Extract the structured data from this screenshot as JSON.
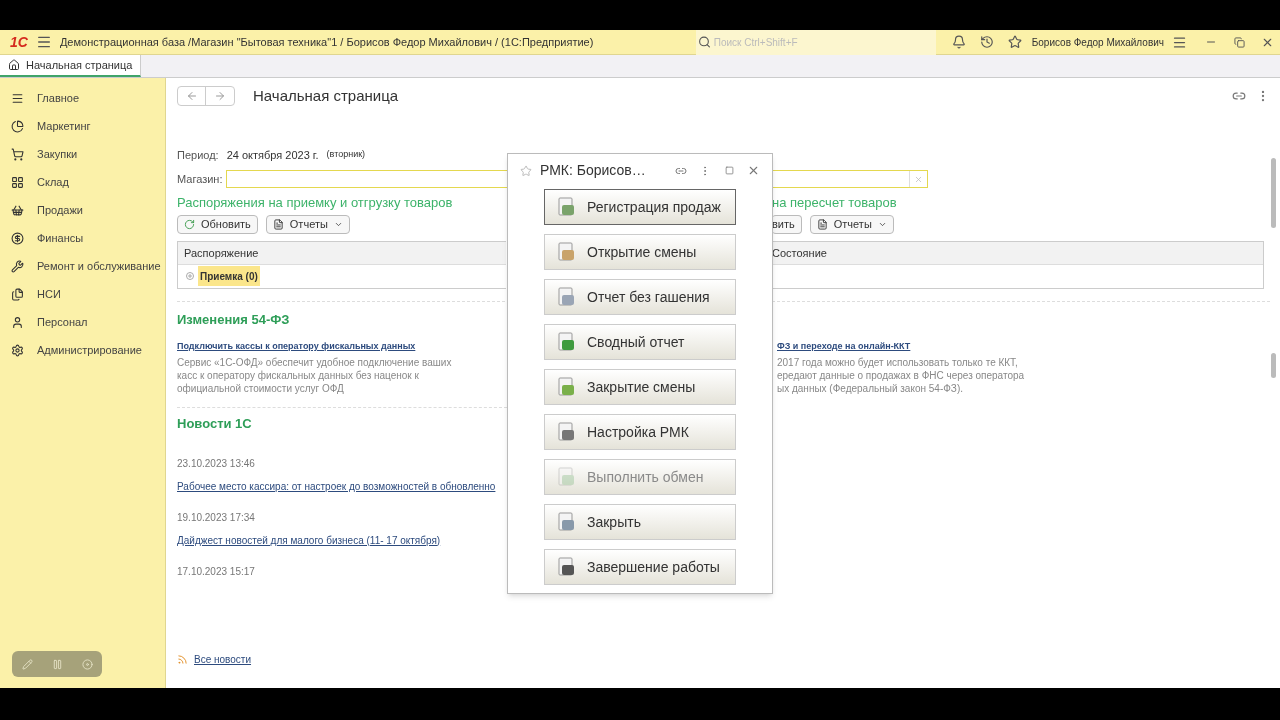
{
  "app": {
    "logo": "1С",
    "title": "Демонстрационная база /Магазин \"Бытовая техника\"1 / Борисов Федор Михайлович /  (1С:Предприятие)",
    "search": {
      "placeholder": "Поиск Ctrl+Shift+F"
    },
    "user": "Борисов Федор Михайлович"
  },
  "tabs": [
    {
      "label": "Начальная страница",
      "selected": true
    }
  ],
  "sidebar": {
    "items": [
      {
        "label": "Главное"
      },
      {
        "label": "Маркетинг"
      },
      {
        "label": "Закупки"
      },
      {
        "label": "Склад"
      },
      {
        "label": "Продажи"
      },
      {
        "label": "Финансы"
      },
      {
        "label": "Ремонт и обслуживание"
      },
      {
        "label": "НСИ"
      },
      {
        "label": "Персонал"
      },
      {
        "label": "Администрирование"
      }
    ]
  },
  "page": {
    "title": "Начальная страница",
    "period": {
      "label": "Период:",
      "value": "24 октября 2023 г.",
      "weekday": "(вторник)"
    },
    "store": {
      "label": "Магазин:"
    }
  },
  "orders_left": {
    "heading": "Распоряжения на приемку и отгрузку товаров",
    "refresh": "Обновить",
    "reports": "Отчеты",
    "column": "Распоряжение",
    "rows": [
      {
        "label": "Приемка (0)",
        "expanded": false
      }
    ]
  },
  "orders_right": {
    "heading": "на пересчет товаров",
    "refresh": "вить",
    "reports": "Отчеты",
    "column": "Состояние"
  },
  "law": {
    "heading": "Изменения 54-ФЗ",
    "left": {
      "link": "Подключить кассы к оператору фискальных данных",
      "text": "Сервис  «1С-ОФД» обеспечит удобное подключение ваших касс к оператору фискальных данных без наценок к официальной стоимости услуг ОФД"
    },
    "right": {
      "link": "ФЗ и переходе на онлайн-ККТ",
      "lines": [
        "2017 года можно будет использовать только те ККТ,",
        "ередают данные о продажах в ФНС через оператора",
        "ых данных (Федеральный закон 54-ФЗ)."
      ]
    }
  },
  "news": {
    "heading": "Новости 1С",
    "items": [
      {
        "date": "23.10.2023 13:46",
        "link": "Рабочее место кассира: от настроек до возможностей в обновленно"
      },
      {
        "date": "19.10.2023 17:34",
        "link": "Дайджест новостей для малого бизнеса (11- 17 октября)"
      },
      {
        "date": "17.10.2023 15:17"
      }
    ],
    "all": "Все новости"
  },
  "dialog": {
    "title": "РМК: Борисов…",
    "buttons": [
      {
        "label": "Регистрация продаж",
        "disabled": false,
        "selected": true
      },
      {
        "label": "Открытие смены",
        "disabled": false,
        "selected": false
      },
      {
        "label": "Отчет без гашения",
        "disabled": false,
        "selected": false
      },
      {
        "label": "Сводный отчет",
        "disabled": false,
        "selected": false
      },
      {
        "label": "Закрытие смены",
        "disabled": false,
        "selected": false
      },
      {
        "label": "Настройка РМК",
        "disabled": false,
        "selected": false
      },
      {
        "label": "Выполнить обмен",
        "disabled": true,
        "selected": false
      },
      {
        "label": "Закрыть",
        "disabled": false,
        "selected": false
      },
      {
        "label": "Завершение работы",
        "disabled": false,
        "selected": false
      }
    ]
  }
}
